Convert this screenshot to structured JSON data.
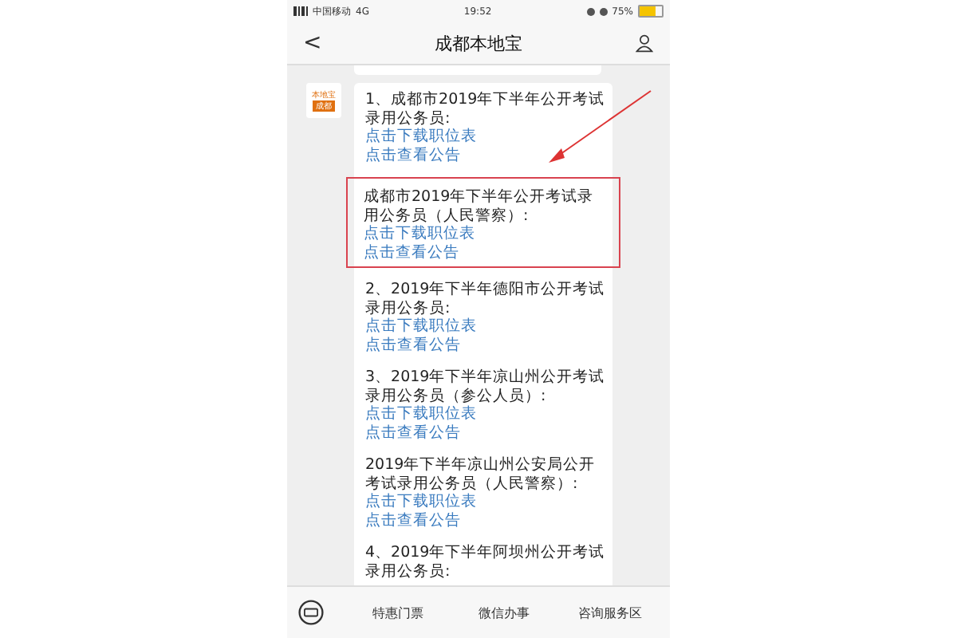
{
  "status_bar": {
    "carrier": "中国移动",
    "network": "4G",
    "time": "19:52",
    "battery": "75%"
  },
  "nav": {
    "back": "<",
    "title": "成都本地宝"
  },
  "avatar": {
    "top": "本地宝",
    "bottom": "成都"
  },
  "items": [
    {
      "title_lines": [
        "1、成都市2019年下半年公开考试",
        "录用公务员:"
      ],
      "links": [
        "点击下载职位表",
        "点击查看公告"
      ],
      "highlighted": false
    },
    {
      "title_lines": [
        "成都市2019年下半年公开考试录",
        "用公务员（人民警察）:"
      ],
      "links": [
        "点击下载职位表",
        "点击查看公告"
      ],
      "highlighted": true
    },
    {
      "title_lines": [
        "2、2019年下半年德阳市公开考试",
        "录用公务员:"
      ],
      "links": [
        "点击下载职位表",
        "点击查看公告"
      ],
      "highlighted": false
    },
    {
      "title_lines": [
        "3、2019年下半年凉山州公开考试",
        "录用公务员（参公人员）:"
      ],
      "links": [
        "点击下载职位表",
        "点击查看公告"
      ],
      "highlighted": false
    },
    {
      "title_lines": [
        "2019年下半年凉山州公安局公开",
        "考试录用公务员（人民警察）:"
      ],
      "links": [
        "点击下载职位表",
        "点击查看公告"
      ],
      "highlighted": false
    },
    {
      "title_lines": [
        "4、2019年下半年阿坝州公开考试",
        "录用公务员:"
      ],
      "highlighted": false
    }
  ],
  "menu": [
    "特惠门票",
    "微信办事",
    "咨询服务区"
  ]
}
